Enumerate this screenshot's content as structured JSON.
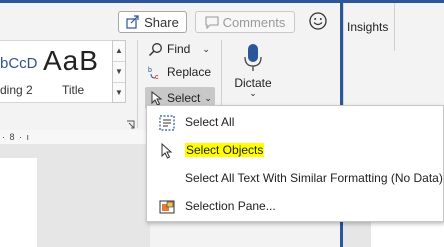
{
  "header": {
    "share_label": "Share",
    "comments_label": "Comments"
  },
  "styles": {
    "sample_1": "bCcD",
    "sample_2": "AaB",
    "name_1": "ding 2",
    "name_2": "Title"
  },
  "editing": {
    "find_label": "Find",
    "replace_label": "Replace",
    "select_label": "Select"
  },
  "voice": {
    "dictate_label": "Dictate"
  },
  "right_panel": {
    "insights_label": "Insights"
  },
  "ruler": {
    "text": "· 8 · ı"
  },
  "select_menu": {
    "items": [
      {
        "label": "Select All",
        "icon": "select-all-icon"
      },
      {
        "label": "Select Objects",
        "icon": "cursor-arrow-icon",
        "highlighted": true
      },
      {
        "label": "Select All Text With Similar Formatting (No Data)",
        "icon": ""
      },
      {
        "label": "Selection Pane...",
        "icon": "selection-pane-icon"
      }
    ]
  },
  "colors": {
    "accent": "#2b579a",
    "highlight": "#ffff00"
  }
}
